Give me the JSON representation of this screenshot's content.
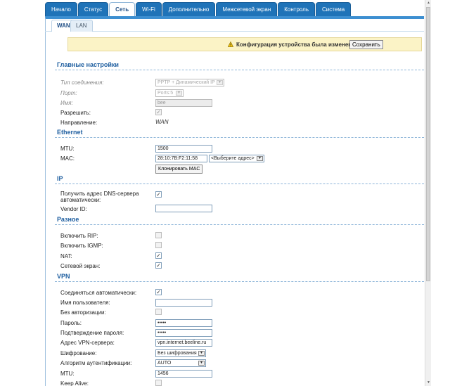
{
  "nav": {
    "tabs": [
      {
        "label": "Начало"
      },
      {
        "label": "Статус"
      },
      {
        "label": "Сеть"
      },
      {
        "label": "Wi-Fi"
      },
      {
        "label": "Дополнительно"
      },
      {
        "label": "Межсетевой экран"
      },
      {
        "label": "Контроль"
      },
      {
        "label": "Система"
      }
    ],
    "active": "Сеть"
  },
  "subnav": {
    "wan": "WAN",
    "lan": "LAN"
  },
  "notice": {
    "message": "Конфигурация устройства была изменена",
    "save_label": "Сохранить"
  },
  "main": {
    "title": "Главные настройки",
    "conn_type_label": "Тип соединения:",
    "conn_type_value": "PPTP + Динамический IP",
    "port_label": "Порт:",
    "port_value": "Ports:5",
    "name_label": "Имя:",
    "name_value": "bee",
    "allow_label": "Разрешить:",
    "direction_label": "Направление:",
    "direction_value": "WAN"
  },
  "ethernet": {
    "title": "Ethernet",
    "mtu_label": "MTU:",
    "mtu_value": "1500",
    "mac_label": "MAC:",
    "mac_value": "28:10:7B:F2:11:58",
    "mac_select": "<Выберите адрес>",
    "clone_label": "Клонировать MAC"
  },
  "ip": {
    "title": "IP",
    "dns_label": "Получить адрес DNS-сервера автоматически:",
    "vendor_label": "Vendor ID:",
    "vendor_value": ""
  },
  "misc": {
    "title": "Разное",
    "rip_label": "Включить RIP:",
    "igmp_label": "Включить IGMP:",
    "nat_label": "NAT:",
    "firewall_label": "Сетевой экран:"
  },
  "vpn": {
    "title": "VPN",
    "auto_label": "Соединяться автоматически:",
    "user_label": "Имя пользователя:",
    "user_value": "",
    "noauth_label": "Без авторизации:",
    "pass_label": "Пароль:",
    "pass_value": "•••••",
    "confirm_label": "Подтверждение пароля:",
    "confirm_value": "•••••",
    "server_label": "Адрес VPN-сервера:",
    "server_value": "vpn.internet.beeline.ru",
    "enc_label": "Шифрование:",
    "enc_value": "Без шифрования",
    "auth_label": "Алгоритм аутентификации:",
    "auth_value": "AUTO",
    "mtu_label": "MTU:",
    "mtu_value": "1456",
    "keepalive_label": "Keep Alive:"
  },
  "checks": {
    "checked": "✓",
    "unchecked": ""
  },
  "colors": {
    "accent": "#1f73b8",
    "notice_bg": "#fbf3c6",
    "section": "#1f5fa0"
  }
}
